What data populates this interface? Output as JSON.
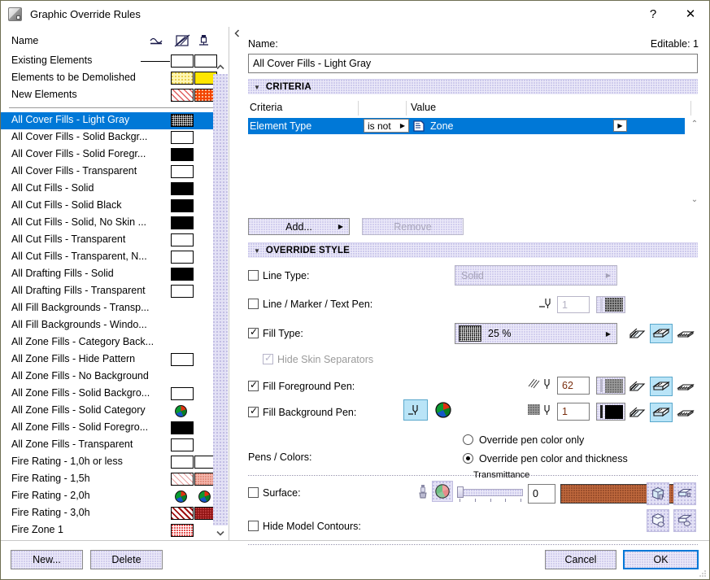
{
  "window": {
    "title": "Graphic Override Rules",
    "app_icon": "archicad-app-icon",
    "help_label": "?",
    "close_label": "✕"
  },
  "left_panel": {
    "column_header": {
      "name_label": "Name",
      "icons": [
        "line-type-column-icon",
        "fill-type-column-icon",
        "pen-column-icon"
      ]
    },
    "static_rows": [
      {
        "name": "Existing Elements",
        "line": true,
        "sw1": "white",
        "sw2": "white"
      },
      {
        "name": "Elements to be Demolished",
        "line": false,
        "sw1": "yellow-dotted",
        "sw2": "yellow"
      },
      {
        "name": "New Elements",
        "line": false,
        "sw1": "red-hatch",
        "sw2": "orange-dotted"
      }
    ],
    "rows": [
      {
        "name": "All Cover Fills - Light Gray",
        "selected": true,
        "sw1": "black-dotted"
      },
      {
        "name": "All Cover Fills - Solid Backgr...",
        "selected": false,
        "sw1": "white"
      },
      {
        "name": "All Cover Fills - Solid Foregr...",
        "selected": false,
        "sw1": "black"
      },
      {
        "name": "All Cover Fills - Transparent",
        "selected": false,
        "sw1": "white"
      },
      {
        "name": "All Cut Fills - Solid",
        "selected": false,
        "sw1": "black"
      },
      {
        "name": "All Cut Fills - Solid Black",
        "selected": false,
        "sw1": "black"
      },
      {
        "name": "All Cut Fills - Solid, No Skin ...",
        "selected": false,
        "sw1": "black"
      },
      {
        "name": "All Cut Fills - Transparent",
        "selected": false,
        "sw1": "white"
      },
      {
        "name": "All Cut Fills - Transparent, N...",
        "selected": false,
        "sw1": "white"
      },
      {
        "name": "All Drafting Fills - Solid",
        "selected": false,
        "sw1": "black"
      },
      {
        "name": "All Drafting Fills - Transparent",
        "selected": false,
        "sw1": "white"
      },
      {
        "name": "All Fill Backgrounds - Transp...",
        "selected": false,
        "sw1": "none"
      },
      {
        "name": "All Fill Backgrounds - Windo...",
        "selected": false,
        "sw1": "none"
      },
      {
        "name": "All Zone Fills - Category Back...",
        "selected": false,
        "sw1": "none"
      },
      {
        "name": "All Zone Fills - Hide Pattern",
        "selected": false,
        "sw1": "white"
      },
      {
        "name": "All Zone Fills - No Background",
        "selected": false,
        "sw1": "none"
      },
      {
        "name": "All Zone Fills - Solid Backgro...",
        "selected": false,
        "sw1": "white"
      },
      {
        "name": "All Zone Fills - Solid Category",
        "selected": false,
        "sw1": "colorwheel"
      },
      {
        "name": "All Zone Fills - Solid Foregro...",
        "selected": false,
        "sw1": "black"
      },
      {
        "name": "All Zone Fills - Transparent",
        "selected": false,
        "sw1": "white"
      },
      {
        "name": "Fire Rating - 1,0h or less",
        "selected": false,
        "sw1": "white",
        "sw2": "white"
      },
      {
        "name": "Fire Rating - 1,5h",
        "selected": false,
        "sw1": "pink-hatch",
        "sw2": "pink-dotted"
      },
      {
        "name": "Fire Rating - 2,0h",
        "selected": false,
        "sw1": "colorwheel",
        "sw2": "colorwheel"
      },
      {
        "name": "Fire Rating - 3,0h",
        "selected": false,
        "sw1": "darkred-hatch",
        "sw2": "darkred"
      },
      {
        "name": "Fire Zone 1",
        "selected": false,
        "sw1": "red-dotted"
      }
    ],
    "scrollbar": {
      "up_icon": "chevron-up-icon",
      "down_icon": "chevron-down-icon"
    }
  },
  "right_panel": {
    "name_label": "Name:",
    "editable_label": "Editable: 1",
    "name_value": "All Cover Fills - Light Gray",
    "criteria_section": {
      "title": "CRITERIA",
      "collapse_icon": "triangle-down-icon",
      "col_criteria": "Criteria",
      "col_value": "Value",
      "rows": [
        {
          "criteria": "Element Type",
          "operator": "is not",
          "value_icon": "zone-element-icon",
          "value": "Zone"
        }
      ]
    },
    "buttons": {
      "add_label": "Add...",
      "remove_label": "Remove"
    },
    "override_section": {
      "title": "OVERRIDE STYLE",
      "collapse_icon": "triangle-down-icon"
    },
    "controls": {
      "line_type": {
        "label": "Line Type:",
        "checked": false,
        "value": "Solid",
        "disabled": true
      },
      "line_marker_text_pen": {
        "label": "Line / Marker / Text Pen:",
        "checked": false,
        "pen_value": "1"
      },
      "fill_type": {
        "label": "Fill Type:",
        "checked": true,
        "value": "25 %"
      },
      "hide_skin_separators": {
        "label": "Hide Skin Separators",
        "checked": true,
        "disabled": true
      },
      "fill_foreground_pen": {
        "label": "Fill Foreground Pen:",
        "checked": true,
        "pen_value": "62"
      },
      "fill_background_pen": {
        "label": "Fill Background Pen:",
        "checked": true,
        "pen_value": "1"
      },
      "pens_colors": {
        "label": "Pens / Colors:",
        "option_color_only": "Override pen color only",
        "option_color_thickness": "Override pen color and thickness",
        "selected": "color_and_thickness"
      },
      "surface": {
        "label": "Surface:",
        "checked": false,
        "transmittance_label": "Transmittance",
        "transmittance_value": "0"
      },
      "hide_model_contours": {
        "label": "Hide Model Contours:",
        "checked": false
      }
    },
    "fill_mode_icons": [
      "cut-fill-icon",
      "cover-fill-icon",
      "drafting-fill-icon"
    ],
    "surface_icons": [
      "surface-3d-icon",
      "surface-elevation-icon"
    ],
    "contour_icons": [
      "contour-3d-icon",
      "contour-elevation-icon"
    ]
  },
  "footer": {
    "new_label": "New...",
    "delete_label": "Delete",
    "cancel_label": "Cancel",
    "ok_label": "OK"
  },
  "colors": {
    "selection_blue": "#0078d7",
    "dotted_panel": "#eceaf9",
    "highlight_cyan": "#b9e4f7"
  }
}
